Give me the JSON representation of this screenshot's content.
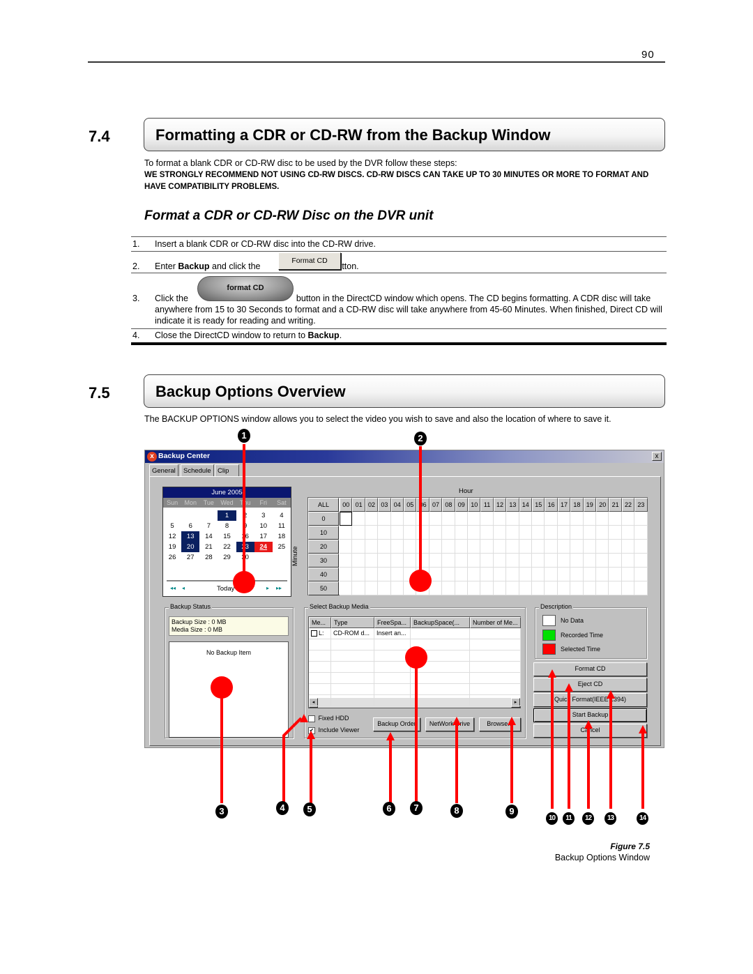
{
  "page_number": "90",
  "section_7_4": {
    "number": "7.4",
    "title": "Formatting a CDR or CD-RW from the Backup Window",
    "intro": "To format a blank CDR or CD-RW disc to be used by the DVR follow these steps:",
    "warning": "WE STRONGLY RECOMMEND NOT USING CD-RW DISCS. CD-RW DISCS CAN TAKE UP TO 30 MINUTES OR MORE TO FORMAT AND HAVE COMPATIBILITY PROBLEMS.",
    "subheading": "Format a CDR or CD-RW Disc on the DVR unit",
    "steps": [
      {
        "n": "1.",
        "text": "Insert a blank CDR or CD-RW disc into the CD-RW drive."
      },
      {
        "n": "2.",
        "pre": "Enter ",
        "bold": "Backup",
        "mid": " and click the ",
        "button": "Format CD",
        "post": " button."
      },
      {
        "n": "3.",
        "pre": "Click the ",
        "button": "format CD",
        "post": " button in the DirectCD window which opens. The CD begins formatting. A CDR disc will take anywhere from 15 to 30 Seconds to format and a CD-RW disc will take anywhere from 45-60 Minutes. When finished, Direct CD will indicate it is ready for reading and writing."
      },
      {
        "n": "4.",
        "pre": "Close the DirectCD window to return to ",
        "bold": "Backup",
        "post": "."
      }
    ]
  },
  "section_7_5": {
    "number": "7.5",
    "title": "Backup Options Overview",
    "intro": "The BACKUP OPTIONS window allows you to select the video you wish to save and also the location of where to save it."
  },
  "window": {
    "title": "Backup Center",
    "close_glyph": "x",
    "tabs": [
      "General",
      "Schedule",
      "Clip"
    ],
    "calendar": {
      "month": "June 2005",
      "weekdays": [
        "Sun",
        "Mon",
        "Tue",
        "Wed",
        "Thu",
        "Fri",
        "Sat"
      ],
      "days": [
        "",
        "",
        "",
        "1",
        "2",
        "3",
        "4",
        "5",
        "6",
        "7",
        "8",
        "9",
        "10",
        "11",
        "12",
        "13",
        "14",
        "15",
        "16",
        "17",
        "18",
        "19",
        "20",
        "21",
        "22",
        "23",
        "24",
        "25",
        "26",
        "27",
        "28",
        "29",
        "30",
        "",
        ""
      ],
      "recorded_days": [
        "1",
        "13",
        "20",
        "23"
      ],
      "today": "24",
      "nav": {
        "first": "◂◂",
        "prev": "◂",
        "today": "Today",
        "next": "▸",
        "last": "▸▸"
      }
    },
    "hour_label": "Hour",
    "minute_label": "Minute",
    "all_label": "ALL",
    "hours": [
      "00",
      "01",
      "02",
      "03",
      "04",
      "05",
      "06",
      "07",
      "08",
      "09",
      "10",
      "11",
      "12",
      "13",
      "14",
      "15",
      "16",
      "17",
      "18",
      "19",
      "20",
      "21",
      "22",
      "23"
    ],
    "minutes": [
      "0",
      "10",
      "20",
      "30",
      "40",
      "50"
    ],
    "backup_status": {
      "label": "Backup Status",
      "backup_size": "Backup Size : 0 MB",
      "media_size": "Media Size : 0 MB",
      "empty_text": "No Backup Item"
    },
    "media": {
      "label": "Select Backup Media",
      "columns": [
        "Me...",
        "Type",
        "FreeSpa...",
        "BackupSpace(...",
        "Number of Me..."
      ],
      "rows": [
        [
          "L:",
          "CD-ROM d...",
          "Insert an...",
          "",
          ""
        ]
      ],
      "fixed_hdd": {
        "label": "Fixed HDD",
        "checked": false
      },
      "include_viewer": {
        "label": "Include Viewer",
        "checked": true
      },
      "buttons": [
        "Backup Order",
        "NetWork Drive",
        "Browse..."
      ]
    },
    "description": {
      "label": "Description",
      "items": [
        {
          "label": "No Data",
          "color": "#ffffff"
        },
        {
          "label": "Recorded Time",
          "color": "#00e000"
        },
        {
          "label": "Selected Time",
          "color": "#ff0000"
        }
      ]
    },
    "action_buttons": [
      "Format CD",
      "Eject CD",
      "Quick Format(IEEE 1394)",
      "Start Backup",
      "Cancel"
    ]
  },
  "callouts": [
    "1",
    "2",
    "3",
    "4",
    "5",
    "6",
    "7",
    "8",
    "9",
    "10",
    "11",
    "12",
    "13",
    "14"
  ],
  "callout_color": "#ff0000",
  "figure": {
    "label": "Figure 7.5",
    "caption": "Backup Options Window"
  }
}
